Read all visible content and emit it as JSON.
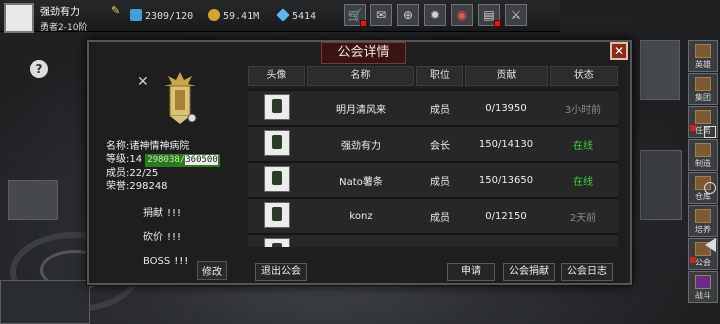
{
  "player": {
    "name": "强劲有力",
    "rank": "勇者2-10阶"
  },
  "resources": {
    "energy": "2309/120",
    "gold": "59.41M",
    "gem": "5414"
  },
  "dialog": {
    "title": "公会详情"
  },
  "guild": {
    "name_label": "名称:",
    "name": "诸神情神病院",
    "level_label": "等级:",
    "level": "14",
    "exp": "298038/",
    "exp_total": "360500",
    "members_label": "成员:",
    "members": "22/25",
    "honor_label": "荣誉:",
    "honor": "298248"
  },
  "actions": {
    "donate": "捐献",
    "bargain": "砍价",
    "boss": "BOSS",
    "mark": "!!!"
  },
  "buttons": {
    "modify": "修改",
    "leave": "退出公会",
    "apply": "申请",
    "donation": "公会捐献",
    "log": "公会日志"
  },
  "table": {
    "headers": [
      "头像",
      "名称",
      "职位",
      "贡献",
      "状态"
    ],
    "rows": [
      {
        "name": "明月清风来",
        "position": "成员",
        "contrib": "0/13950",
        "status": "3小时前"
      },
      {
        "name": "强劲有力",
        "position": "会长",
        "contrib": "150/14130",
        "status": "在线"
      },
      {
        "name": "Nato薯条",
        "position": "成员",
        "contrib": "150/13650",
        "status": "在线"
      },
      {
        "name": "konz",
        "position": "成员",
        "contrib": "0/12150",
        "status": "2天前"
      }
    ]
  },
  "side": [
    "英雄",
    "集团",
    "任务",
    "制造",
    "仓库",
    "培养",
    "公会",
    "战斗"
  ],
  "colors": {
    "online": "#3fd13a",
    "offline": "#8a8a8a",
    "alert": "#d0221b"
  }
}
